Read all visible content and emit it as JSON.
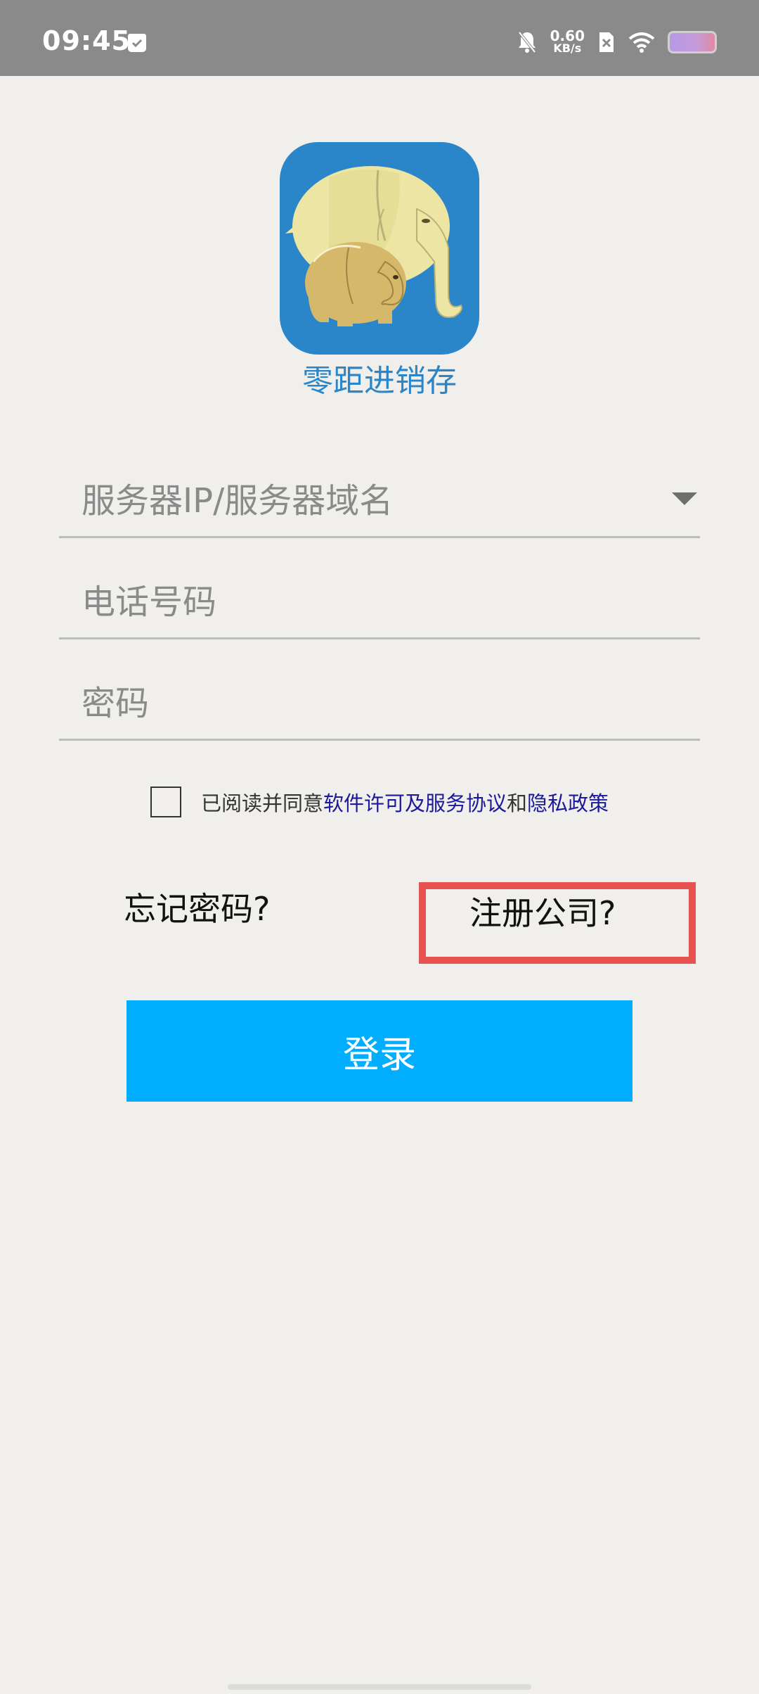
{
  "status_bar": {
    "time": "09:45",
    "net_speed_value": "0.60",
    "net_speed_unit": "KB/s"
  },
  "app": {
    "name": "零距进销存",
    "logo_icon": "elephant-logo-icon"
  },
  "form": {
    "server_placeholder": "服务器IP/服务器域名",
    "phone_placeholder": "电话号码",
    "password_placeholder": "密码"
  },
  "agreement": {
    "prefix": "已阅读并同意",
    "license_link": "软件许可及服务协议",
    "and": "和",
    "privacy_link": "隐私政策"
  },
  "links": {
    "forgot_password": "忘记密码?",
    "register_company": "注册公司?"
  },
  "login_button": "登录",
  "colors": {
    "accent": "#00adff",
    "brand": "#2a86c9",
    "highlight_box": "#e8534f",
    "link": "#1a1a9a"
  }
}
